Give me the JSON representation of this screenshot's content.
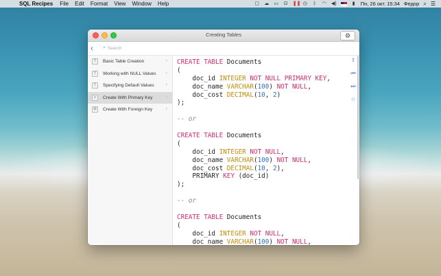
{
  "menubar": {
    "app_name": "SQL Recipes",
    "menus": [
      "File",
      "Edit",
      "Format",
      "View",
      "Window",
      "Help"
    ],
    "clock": "Пн, 26 окт.  15:34",
    "user": "Федор"
  },
  "window": {
    "title": "Creating Tables",
    "search_placeholder": "Search"
  },
  "sidebar": {
    "items": [
      {
        "label": "Basic Table Creation",
        "icon": "T",
        "selected": false
      },
      {
        "label": "Working with NULL Values",
        "icon": "T",
        "selected": false
      },
      {
        "label": "Specifying Default Values",
        "icon": "T",
        "selected": false
      },
      {
        "label": "Create With Primary Key",
        "icon": "pk",
        "selected": true
      },
      {
        "label": "Create With Foreign Key",
        "icon": "fk",
        "selected": false
      }
    ]
  },
  "code": {
    "lines": [
      [
        [
          "kw",
          "CREATE"
        ],
        [
          "t",
          " "
        ],
        [
          "kw",
          "TABLE"
        ],
        [
          "t",
          " Documents"
        ]
      ],
      [
        [
          "t",
          "("
        ]
      ],
      [
        [
          "t",
          "    doc_id "
        ],
        [
          "ty",
          "INTEGER"
        ],
        [
          "t",
          " "
        ],
        [
          "kw",
          "NOT NULL"
        ],
        [
          "t",
          " "
        ],
        [
          "kw",
          "PRIMARY KEY"
        ],
        [
          "t",
          ","
        ]
      ],
      [
        [
          "t",
          "    doc_name "
        ],
        [
          "ty",
          "VARCHAR"
        ],
        [
          "t",
          "("
        ],
        [
          "nm",
          "100"
        ],
        [
          "t",
          ") "
        ],
        [
          "kw",
          "NOT NULL"
        ],
        [
          "t",
          ","
        ]
      ],
      [
        [
          "t",
          "    doc_cost "
        ],
        [
          "ty",
          "DECIMAL"
        ],
        [
          "t",
          "("
        ],
        [
          "nm",
          "10"
        ],
        [
          "t",
          ", "
        ],
        [
          "nm",
          "2"
        ],
        [
          "t",
          ")"
        ]
      ],
      [
        [
          "t",
          ");"
        ]
      ],
      [
        [
          "t",
          ""
        ]
      ],
      [
        [
          "cm",
          "-- or"
        ]
      ],
      [
        [
          "t",
          ""
        ]
      ],
      [
        [
          "kw",
          "CREATE"
        ],
        [
          "t",
          " "
        ],
        [
          "kw",
          "TABLE"
        ],
        [
          "t",
          " Documents"
        ]
      ],
      [
        [
          "t",
          "("
        ]
      ],
      [
        [
          "t",
          "    doc_id "
        ],
        [
          "ty",
          "INTEGER"
        ],
        [
          "t",
          " "
        ],
        [
          "kw",
          "NOT NULL"
        ],
        [
          "t",
          ","
        ]
      ],
      [
        [
          "t",
          "    doc_name "
        ],
        [
          "ty",
          "VARCHAR"
        ],
        [
          "t",
          "("
        ],
        [
          "nm",
          "100"
        ],
        [
          "t",
          ") "
        ],
        [
          "kw",
          "NOT NULL"
        ],
        [
          "t",
          ","
        ]
      ],
      [
        [
          "t",
          "    doc_cost "
        ],
        [
          "ty",
          "DECIMAL"
        ],
        [
          "t",
          "("
        ],
        [
          "nm",
          "10"
        ],
        [
          "t",
          ", "
        ],
        [
          "nm",
          "2"
        ],
        [
          "t",
          "),"
        ]
      ],
      [
        [
          "t",
          "    PRIMARY "
        ],
        [
          "kw",
          "KEY"
        ],
        [
          "t",
          " (doc_id)"
        ]
      ],
      [
        [
          "t",
          ");"
        ]
      ],
      [
        [
          "t",
          ""
        ]
      ],
      [
        [
          "cm",
          "-- or"
        ]
      ],
      [
        [
          "t",
          ""
        ]
      ],
      [
        [
          "kw",
          "CREATE"
        ],
        [
          "t",
          " "
        ],
        [
          "kw",
          "TABLE"
        ],
        [
          "t",
          " Documents"
        ]
      ],
      [
        [
          "t",
          "("
        ]
      ],
      [
        [
          "t",
          "    doc_id "
        ],
        [
          "ty",
          "INTEGER"
        ],
        [
          "t",
          " "
        ],
        [
          "kw",
          "NOT NULL"
        ],
        [
          "t",
          ","
        ]
      ],
      [
        [
          "t",
          "    doc_name "
        ],
        [
          "ty",
          "VARCHAR"
        ],
        [
          "t",
          "("
        ],
        [
          "nm",
          "100"
        ],
        [
          "t",
          ") "
        ],
        [
          "kw",
          "NOT NULL"
        ],
        [
          "t",
          ","
        ]
      ]
    ]
  },
  "colors": {
    "keyword": "#d02c6c",
    "type": "#c58a0a",
    "number": "#2f6fc8",
    "comment": "#888888",
    "accent": "#3c83f6"
  },
  "rail_icons": [
    "share-icon",
    "first-page-icon",
    "last-page-icon",
    "star-icon"
  ]
}
